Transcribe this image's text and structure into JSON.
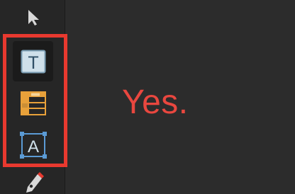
{
  "toolbar": {
    "tools": [
      {
        "id": "select",
        "icon": "arrow-pointer-icon",
        "selected": false
      },
      {
        "id": "text",
        "icon": "text-box-icon",
        "icon_letter": "T",
        "selected": true
      },
      {
        "id": "table",
        "icon": "table-icon",
        "selected": false
      },
      {
        "id": "artistic-text",
        "icon": "frame-text-icon",
        "icon_letter": "A",
        "selected": false
      },
      {
        "id": "pen",
        "icon": "pen-icon",
        "selected": false
      }
    ]
  },
  "annotation": {
    "text": "Yes.",
    "color": "#e9473f",
    "highlight_color": "#e8392f"
  },
  "colors": {
    "text_icon_fill": "#cfe0ea",
    "text_icon_stroke": "#7a9db3",
    "table_icon": "#e8a13a",
    "frame_icon": "#5b9bd5"
  }
}
